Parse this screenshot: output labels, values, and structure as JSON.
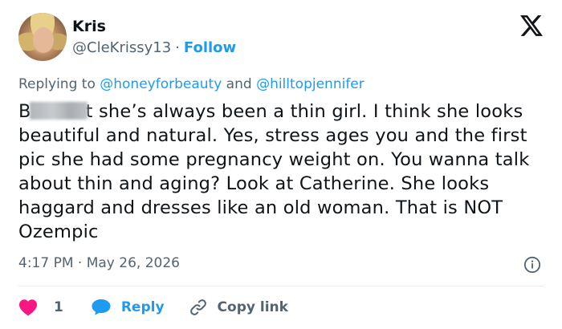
{
  "author": {
    "name": "Kris",
    "handle": "@CleKrissy13",
    "separator": "·",
    "follow_label": "Follow"
  },
  "platform_icon": "x-logo-icon",
  "reply_context": {
    "prefix": "Replying to",
    "user1": "@honeyforbeauty",
    "conjunction": "and",
    "user2": "@hilltopjennifer"
  },
  "post": {
    "text_start": "B",
    "text_rest": "t she’s always been a thin girl. I think she looks beautiful and natural. Yes, stress ages you and the first pic she had some pregnancy weight on. You wanna talk about thin and aging? Look at Catherine. She looks haggard and dresses like an old woman. That is NOT Ozempic"
  },
  "meta": {
    "time": "4:17 PM",
    "separator": "·",
    "date": "May 26, 2026"
  },
  "actions": {
    "like_count": "1",
    "reply_label": "Reply",
    "copy_label": "Copy link"
  },
  "colors": {
    "accent": "#1d9bf0",
    "like": "#f91880",
    "muted": "#536471",
    "text": "#0f1419"
  }
}
